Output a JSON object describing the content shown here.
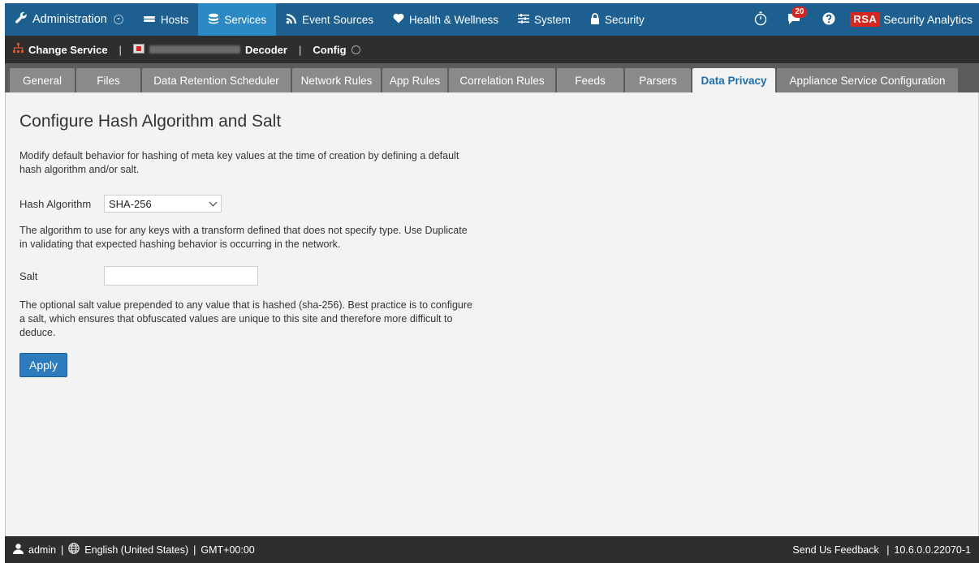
{
  "topnav": {
    "admin_label": "Administration",
    "hosts_label": "Hosts",
    "services_label": "Services",
    "event_sources_label": "Event Sources",
    "health_label": "Health & Wellness",
    "system_label": "System",
    "security_label": "Security",
    "notification_count": "20",
    "brand_logo": "RSA",
    "brand_name": "Security Analytics",
    "icons": [
      "wrench-icon",
      "hosts-icon",
      "database-icon",
      "rss-icon",
      "heart-icon",
      "sliders-icon",
      "lock-icon",
      "stopwatch-icon",
      "chat-icon",
      "help-icon"
    ]
  },
  "subbar": {
    "change_service_label": "Change Service",
    "service_type": "Decoder",
    "config_label": "Config"
  },
  "tabs": [
    {
      "label": "General"
    },
    {
      "label": "Files"
    },
    {
      "label": "Data Retention Scheduler"
    },
    {
      "label": "Network Rules"
    },
    {
      "label": "App Rules"
    },
    {
      "label": "Correlation Rules"
    },
    {
      "label": "Feeds"
    },
    {
      "label": "Parsers"
    },
    {
      "label": "Data Privacy"
    },
    {
      "label": "Appliance Service Configuration"
    }
  ],
  "active_tab": "Data Privacy",
  "main": {
    "title": "Configure Hash Algorithm and Salt",
    "intro": "Modify default behavior for hashing of meta key values at the time of creation by defining a default hash algorithm and/or salt.",
    "hash_label": "Hash Algorithm",
    "hash_value": "SHA-256",
    "hash_help": "The algorithm to use for any keys with a transform defined that does not specify type. Use Duplicate in validating that expected hashing behavior is occurring in the network.",
    "salt_label": "Salt",
    "salt_value": "",
    "salt_placeholder": "",
    "salt_help": "The optional salt value prepended to any value that is hashed (sha-256). Best practice is to configure a salt, which ensures that obfuscated values are unique to this site and therefore more difficult to deduce.",
    "apply_label": "Apply"
  },
  "footer": {
    "user": "admin",
    "language": "English (United States)",
    "timezone": "GMT+00:00",
    "feedback": "Send Us Feedback",
    "version": "10.6.0.0.22070-1"
  },
  "colors": {
    "nav_bg": "#1d5f8f",
    "nav_active": "#2b89c5",
    "dark_bar": "#2e2e2e",
    "tab_bar": "#5c5c5c",
    "tab_bg": "#8a8a8a",
    "accent": "#1c6fa8",
    "button": "#2b7bbd",
    "badge": "#d7251f"
  }
}
